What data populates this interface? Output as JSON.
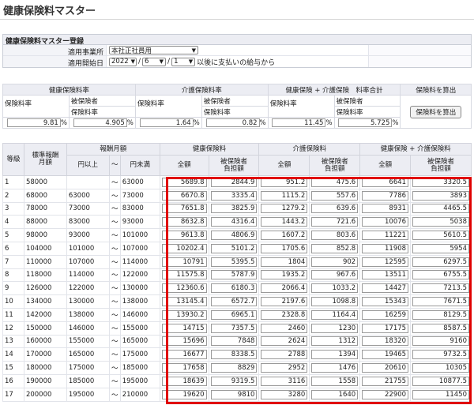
{
  "page": {
    "title": "健康保険料マスター"
  },
  "registration": {
    "heading": "健康保険料マスター登録",
    "office_label": "適用事業所",
    "office_value": "本社正社員用",
    "start_label": "適用開始日",
    "start_year": "2022",
    "start_month": "6",
    "start_day": "1",
    "start_suffix": "以後に支払いの給与から"
  },
  "rates": {
    "groups": [
      "健康保険料率",
      "介護保険料率",
      "健康保険 + 介護保険　料率合計",
      "保険料を算出"
    ],
    "rate_label": "保険料率",
    "insured_label_1": "被保険者",
    "insured_label_2": "保険料率",
    "health_rate": "9.81",
    "health_insured": "4.905",
    "care_rate": "1.64",
    "care_insured": "0.82",
    "total_rate": "11.45",
    "total_insured": "5.725",
    "pct": "%",
    "calc_button": "保険料を算出"
  },
  "grid": {
    "h_grade": "等級",
    "h_std_1": "標準報酬",
    "h_std_2": "月額",
    "h_range": "報酬月額",
    "h_from": "円以上",
    "h_tilde": "～",
    "h_to": "円未満",
    "h_health": "健康保険料",
    "h_care": "介護保険料",
    "h_total": "健康保険 + 介護保険料",
    "h_full": "全額",
    "h_insured_1": "被保険者",
    "h_insured_2": "負担額",
    "rows": [
      {
        "grade": "1",
        "std": "58000",
        "from": "",
        "to": "63000",
        "hf": "5689.8",
        "hi": "2844.9",
        "cf": "951.2",
        "ci": "475.6",
        "tf": "6641",
        "ti": "3320.5"
      },
      {
        "grade": "2",
        "std": "68000",
        "from": "63000",
        "to": "73000",
        "hf": "6670.8",
        "hi": "3335.4",
        "cf": "1115.2",
        "ci": "557.6",
        "tf": "7786",
        "ti": "3893"
      },
      {
        "grade": "3",
        "std": "78000",
        "from": "73000",
        "to": "83000",
        "hf": "7651.8",
        "hi": "3825.9",
        "cf": "1279.2",
        "ci": "639.6",
        "tf": "8931",
        "ti": "4465.5"
      },
      {
        "grade": "4",
        "std": "88000",
        "from": "83000",
        "to": "93000",
        "hf": "8632.8",
        "hi": "4316.4",
        "cf": "1443.2",
        "ci": "721.6",
        "tf": "10076",
        "ti": "5038"
      },
      {
        "grade": "5",
        "std": "98000",
        "from": "93000",
        "to": "101000",
        "hf": "9613.8",
        "hi": "4806.9",
        "cf": "1607.2",
        "ci": "803.6",
        "tf": "11221",
        "ti": "5610.5"
      },
      {
        "grade": "6",
        "std": "104000",
        "from": "101000",
        "to": "107000",
        "hf": "10202.4",
        "hi": "5101.2",
        "cf": "1705.6",
        "ci": "852.8",
        "tf": "11908",
        "ti": "5954"
      },
      {
        "grade": "7",
        "std": "110000",
        "from": "107000",
        "to": "114000",
        "hf": "10791",
        "hi": "5395.5",
        "cf": "1804",
        "ci": "902",
        "tf": "12595",
        "ti": "6297.5"
      },
      {
        "grade": "8",
        "std": "118000",
        "from": "114000",
        "to": "122000",
        "hf": "11575.8",
        "hi": "5787.9",
        "cf": "1935.2",
        "ci": "967.6",
        "tf": "13511",
        "ti": "6755.5"
      },
      {
        "grade": "9",
        "std": "126000",
        "from": "122000",
        "to": "130000",
        "hf": "12360.6",
        "hi": "6180.3",
        "cf": "2066.4",
        "ci": "1033.2",
        "tf": "14427",
        "ti": "7213.5"
      },
      {
        "grade": "10",
        "std": "134000",
        "from": "130000",
        "to": "138000",
        "hf": "13145.4",
        "hi": "6572.7",
        "cf": "2197.6",
        "ci": "1098.8",
        "tf": "15343",
        "ti": "7671.5"
      },
      {
        "grade": "11",
        "std": "142000",
        "from": "138000",
        "to": "146000",
        "hf": "13930.2",
        "hi": "6965.1",
        "cf": "2328.8",
        "ci": "1164.4",
        "tf": "16259",
        "ti": "8129.5"
      },
      {
        "grade": "12",
        "std": "150000",
        "from": "146000",
        "to": "155000",
        "hf": "14715",
        "hi": "7357.5",
        "cf": "2460",
        "ci": "1230",
        "tf": "17175",
        "ti": "8587.5"
      },
      {
        "grade": "13",
        "std": "160000",
        "from": "155000",
        "to": "165000",
        "hf": "15696",
        "hi": "7848",
        "cf": "2624",
        "ci": "1312",
        "tf": "18320",
        "ti": "9160"
      },
      {
        "grade": "14",
        "std": "170000",
        "from": "165000",
        "to": "175000",
        "hf": "16677",
        "hi": "8338.5",
        "cf": "2788",
        "ci": "1394",
        "tf": "19465",
        "ti": "9732.5"
      },
      {
        "grade": "15",
        "std": "180000",
        "from": "175000",
        "to": "185000",
        "hf": "17658",
        "hi": "8829",
        "cf": "2952",
        "ci": "1476",
        "tf": "20610",
        "ti": "10305"
      },
      {
        "grade": "16",
        "std": "190000",
        "from": "185000",
        "to": "195000",
        "hf": "18639",
        "hi": "9319.5",
        "cf": "3116",
        "ci": "1558",
        "tf": "21755",
        "ti": "10877.5"
      },
      {
        "grade": "17",
        "std": "200000",
        "from": "195000",
        "to": "210000",
        "hf": "19620",
        "hi": "9810",
        "cf": "3280",
        "ci": "1640",
        "tf": "22900",
        "ti": "11450"
      }
    ]
  },
  "colors": {
    "header_bg": "#ecedf3",
    "highlight_border": "#e00000"
  }
}
